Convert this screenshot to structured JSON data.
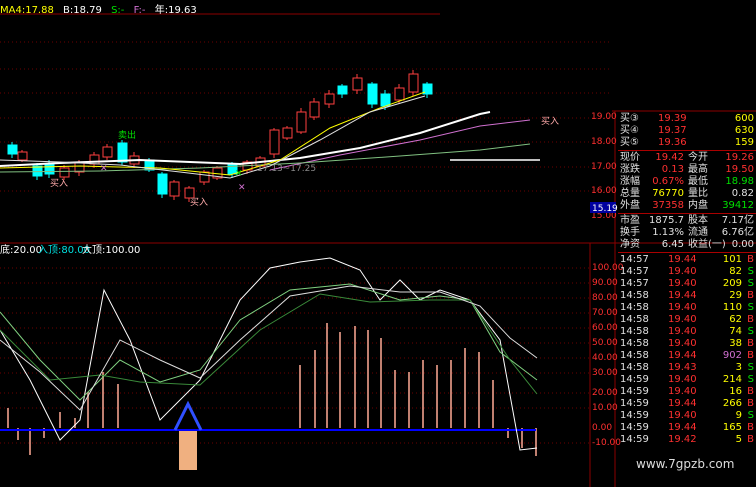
{
  "header": {
    "ma4": "MA4:17.88",
    "b": "B:18.79",
    "s": "S:-",
    "f": "F:-",
    "year": "年:19.63"
  },
  "indicator_header": {
    "low": "底:20.00",
    "enter": "入顶:80.00",
    "big": "大顶:100.00"
  },
  "price_axis": [
    "19.00",
    "18.00",
    "17.00",
    "16.00",
    "15.00"
  ],
  "price_current": "15.19",
  "indicator_axis": [
    "100.00",
    "90.00",
    "80.00",
    "70.00",
    "60.00",
    "50.00",
    "40.00",
    "30.00",
    "20.00",
    "10.00",
    "0.00",
    "-10.00"
  ],
  "chart_labels": {
    "buy1": "买入",
    "buy2": "买入",
    "buy3": "买入",
    "sell1": "卖出",
    "mid": "17.13~17.25"
  },
  "quote": {
    "rows": [
      {
        "label": "买③",
        "value": "19.39",
        "vol": "600"
      },
      {
        "label": "买④",
        "value": "19.37",
        "vol": "630"
      },
      {
        "label": "买⑤",
        "value": "19.36",
        "vol": "159"
      }
    ],
    "stats": [
      {
        "l1": "现价",
        "v1": "19.42",
        "l2": "今开",
        "v2": "19.26"
      },
      {
        "l1": "涨跌",
        "v1": "0.13",
        "l2": "最高",
        "v2": "19.50"
      },
      {
        "l1": "涨幅",
        "v1": "0.67%",
        "l2": "最低",
        "v2": "18.98"
      },
      {
        "l1": "总量",
        "v1": "76770",
        "l2": "量比",
        "v2": "0.82"
      },
      {
        "l1": "外盘",
        "v1": "37358",
        "l2": "内盘",
        "v2": "39412"
      }
    ],
    "stats2": [
      {
        "l1": "市盈",
        "v1": "1875.7",
        "l2": "股本",
        "v2": "7.17亿"
      },
      {
        "l1": "换手",
        "v1": "1.13%",
        "l2": "流通",
        "v2": "6.76亿"
      },
      {
        "l1": "净资",
        "v1": "6.45",
        "l2": "收益(一)",
        "v2": "0.00"
      }
    ],
    "ticks": [
      {
        "t": "14:57",
        "p": "19.44",
        "v": "101",
        "s": "B"
      },
      {
        "t": "14:57",
        "p": "19.40",
        "v": "82",
        "s": "S"
      },
      {
        "t": "14:57",
        "p": "19.40",
        "v": "209",
        "s": "S"
      },
      {
        "t": "14:58",
        "p": "19.44",
        "v": "29",
        "s": "B"
      },
      {
        "t": "14:58",
        "p": "19.40",
        "v": "110",
        "s": "S"
      },
      {
        "t": "14:58",
        "p": "19.40",
        "v": "62",
        "s": "B"
      },
      {
        "t": "14:58",
        "p": "19.40",
        "v": "74",
        "s": "S"
      },
      {
        "t": "14:58",
        "p": "19.40",
        "v": "38",
        "s": "B"
      },
      {
        "t": "14:58",
        "p": "19.44",
        "v": "902",
        "s": "B"
      },
      {
        "t": "14:58",
        "p": "19.43",
        "v": "3",
        "s": "S"
      },
      {
        "t": "14:59",
        "p": "19.40",
        "v": "214",
        "s": "S"
      },
      {
        "t": "14:59",
        "p": "19.40",
        "v": "16",
        "s": "B"
      },
      {
        "t": "14:59",
        "p": "19.44",
        "v": "266",
        "s": "B"
      },
      {
        "t": "14:59",
        "p": "19.40",
        "v": "9",
        "s": "S"
      },
      {
        "t": "14:59",
        "p": "19.44",
        "v": "165",
        "s": "B"
      },
      {
        "t": "14:59",
        "p": "19.42",
        "v": "5",
        "s": "B"
      }
    ]
  },
  "watermark": "www.7gpzb.com",
  "colors": {
    "red": "#ff3030",
    "green": "#00e000",
    "cyan": "#00ffff",
    "yellow": "#ffff00",
    "purple": "#d070d0",
    "white": "#ffffff",
    "grid": "#8b0000",
    "blue": "#0000ff"
  }
}
